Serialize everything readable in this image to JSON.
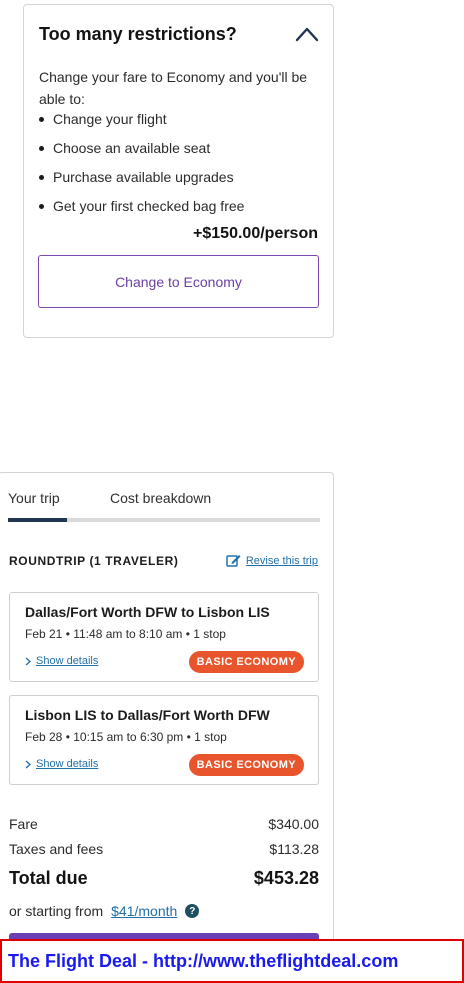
{
  "restrictions": {
    "title": "Too many restrictions?",
    "intro": "Change your fare to Economy and you'll be able to:",
    "benefits": [
      "Change your flight",
      "Choose an available seat",
      "Purchase available upgrades",
      "Get your first checked bag free"
    ],
    "price": "+$150.00/person",
    "button_label": "Change to Economy"
  },
  "trip_summary": {
    "tabs": [
      {
        "label": "Your trip",
        "active": true
      },
      {
        "label": "Cost breakdown",
        "active": false
      }
    ],
    "roundtrip_title": "ROUNDTRIP (1 TRAVELER)",
    "revise_label": "Revise this trip",
    "flights": [
      {
        "route": "Dallas/Fort Worth DFW to Lisbon LIS",
        "time": "Feb 21 • 11:48 am to 8:10 am • 1 stop",
        "details_label": "Show details",
        "fare_class": "BASIC ECONOMY"
      },
      {
        "route": "Lisbon LIS to Dallas/Fort Worth DFW",
        "time": "Feb 28 • 10:15 am to 6:30 pm • 1 stop",
        "details_label": "Show details",
        "fare_class": "BASIC ECONOMY"
      }
    ],
    "costs": {
      "fare_label": "Fare",
      "fare_value": "$340.00",
      "taxes_label": "Taxes and fees",
      "taxes_value": "$113.28",
      "total_label": "Total due",
      "total_value": "$453.28"
    },
    "financing": {
      "prefix": "or starting from",
      "link": "$41/month"
    }
  },
  "banner": {
    "text": "The Flight Deal - http://www.theflightdeal.com"
  },
  "colors": {
    "accent_purple": "#6b3fb5",
    "badge_orange": "#e8552c",
    "link_blue": "#2270a8",
    "tab_active": "#1f3552",
    "banner_border": "#e00000",
    "banner_text": "#1a1aee"
  },
  "icons": {
    "collapse": "chevron-up-icon",
    "revise": "edit-icon",
    "details": "chevron-right-icon",
    "help": "question-icon"
  }
}
